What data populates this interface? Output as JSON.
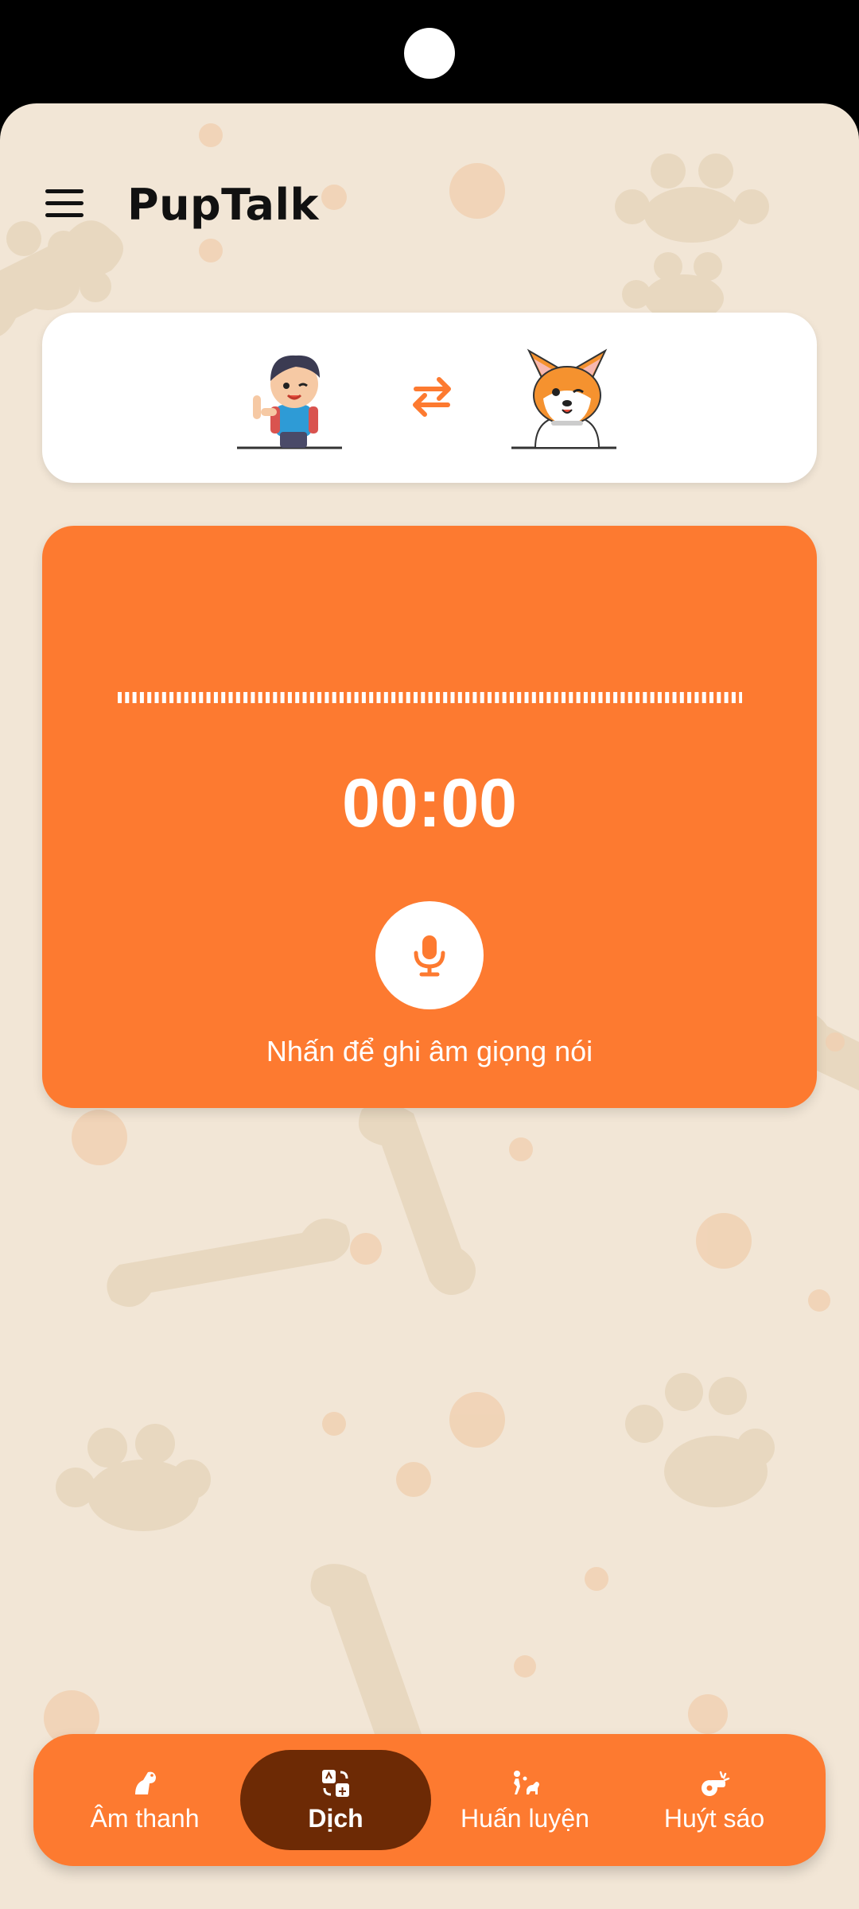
{
  "app": {
    "title": "PupTalk"
  },
  "recorder": {
    "timer": "00:00",
    "hint": "Nhấn để ghi âm giọng nói"
  },
  "nav": {
    "items": [
      {
        "label": "Âm thanh",
        "icon": "dog-sound-icon",
        "active": false
      },
      {
        "label": "Dịch",
        "icon": "translate-icon",
        "active": true
      },
      {
        "label": "Huấn luyện",
        "icon": "training-icon",
        "active": false
      },
      {
        "label": "Huýt sáo",
        "icon": "whistle-icon",
        "active": false
      }
    ]
  },
  "colors": {
    "accent": "#fd7a30",
    "background": "#f2e6d6",
    "nav_active": "#6d2a05",
    "text_dark": "#111111"
  }
}
